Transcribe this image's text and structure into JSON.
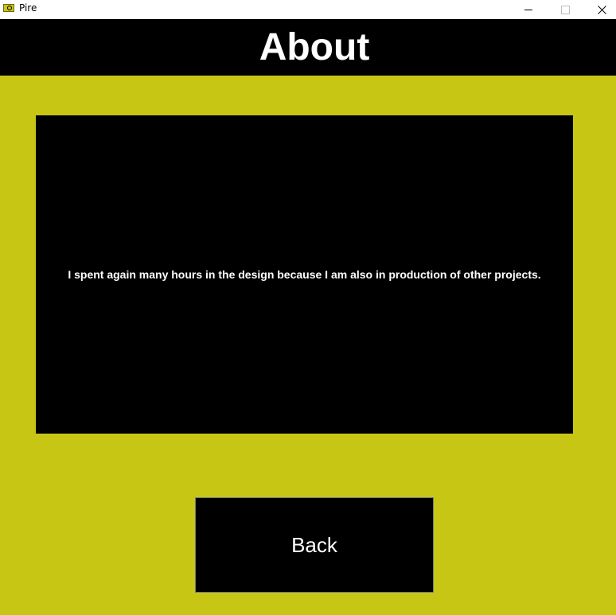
{
  "window": {
    "title": "Pire",
    "app_icon": "pire-app-icon",
    "controls": {
      "minimize_icon": "minimize-icon",
      "maximize_icon": "maximize-icon",
      "close_icon": "close-icon"
    }
  },
  "header": {
    "title": "About"
  },
  "content": {
    "text": "I spent again many hours in the design because I am also in production of other projects."
  },
  "actions": {
    "back_label": "Back"
  },
  "colors": {
    "background": "#c8c615",
    "panel": "#000000",
    "text": "#ffffff"
  }
}
